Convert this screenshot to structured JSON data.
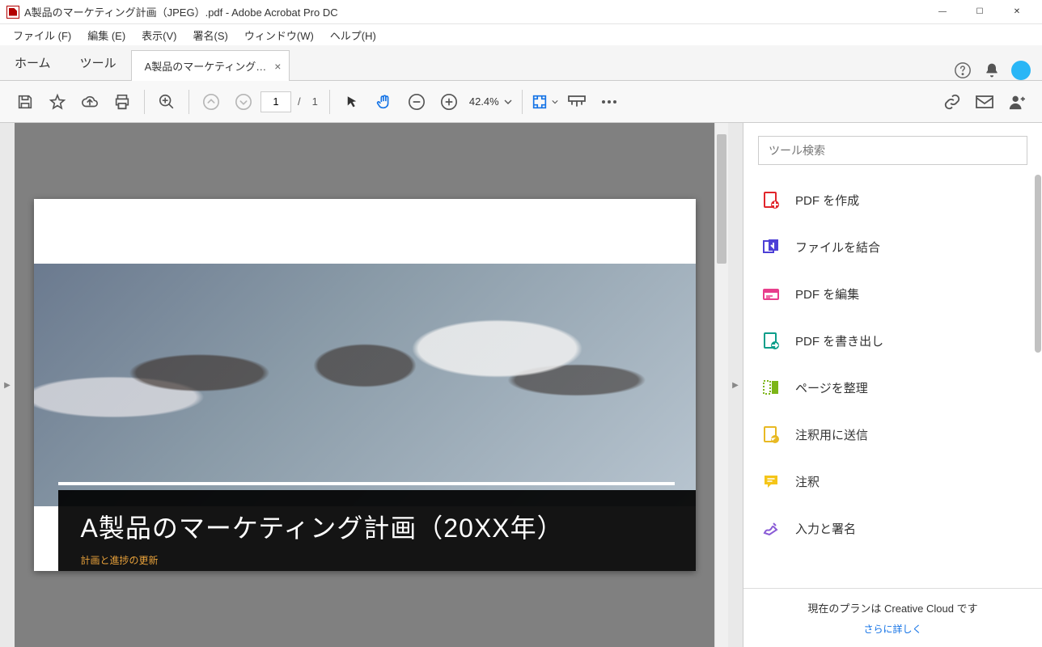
{
  "window": {
    "title": "A製品のマーケティング計画（JPEG）.pdf - Adobe Acrobat Pro DC",
    "controls": {
      "minimize": "—",
      "maximize": "☐",
      "close": "✕"
    }
  },
  "menu": {
    "file": "ファイル (F)",
    "edit": "編集 (E)",
    "view": "表示(V)",
    "sign": "署名(S)",
    "window": "ウィンドウ(W)",
    "help": "ヘルプ(H)"
  },
  "tabs": {
    "home": "ホーム",
    "tools": "ツール",
    "doc_tab": "A製品のマーケティング…"
  },
  "toolbar": {
    "page_current": "1",
    "page_sep": "/",
    "page_total": "1",
    "zoom_value": "42.4%"
  },
  "document": {
    "title": "A製品のマーケティング計画（20XX年）",
    "subtitle": "計画と進捗の更新"
  },
  "right_panel": {
    "search_placeholder": "ツール検索",
    "tools": [
      {
        "label": "PDF を作成",
        "color": "#e1252b",
        "icon": "create"
      },
      {
        "label": "ファイルを結合",
        "color": "#4d3fd6",
        "icon": "combine"
      },
      {
        "label": "PDF を編集",
        "color": "#e83e8c",
        "icon": "edit"
      },
      {
        "label": "PDF を書き出し",
        "color": "#0d9e8a",
        "icon": "export"
      },
      {
        "label": "ページを整理",
        "color": "#7cb518",
        "icon": "organize"
      },
      {
        "label": "注釈用に送信",
        "color": "#e8b923",
        "icon": "send"
      },
      {
        "label": "注釈",
        "color": "#f5c518",
        "icon": "comment"
      },
      {
        "label": "入力と署名",
        "color": "#8a5cd6",
        "icon": "fillsign"
      }
    ],
    "footer_plan": "現在のプランは Creative Cloud です",
    "footer_more": "さらに詳しく"
  }
}
